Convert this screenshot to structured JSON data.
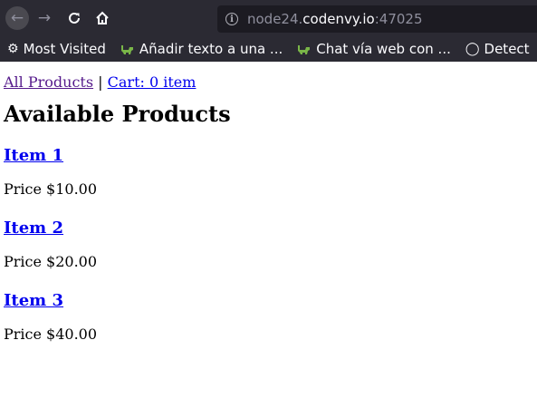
{
  "browser": {
    "url_host": "node24.",
    "url_domain": "codenvy.io",
    "url_port": ":47025",
    "bookmarks": [
      {
        "label": "Most Visited",
        "icon": "gear-icon"
      },
      {
        "label": "Añadir texto a una ...",
        "icon": "dino-icon"
      },
      {
        "label": "Chat vía web con ...",
        "icon": "dino-icon"
      },
      {
        "label": "Detect",
        "icon": "globe-icon"
      }
    ]
  },
  "nav": {
    "all_products": "All Products",
    "separator": " | ",
    "cart": "Cart: 0 item"
  },
  "heading": "Available Products",
  "products": [
    {
      "name": "Item 1",
      "price": "Price $10.00"
    },
    {
      "name": "Item 2",
      "price": "Price $20.00"
    },
    {
      "name": "Item 3",
      "price": "Price $40.00"
    }
  ],
  "colors": {
    "chrome_bg": "#2b2a33",
    "urlbar_bg": "#1c1b22",
    "link": "#0000ee",
    "visited_link": "#551a8b",
    "dino": "#7ab648"
  }
}
